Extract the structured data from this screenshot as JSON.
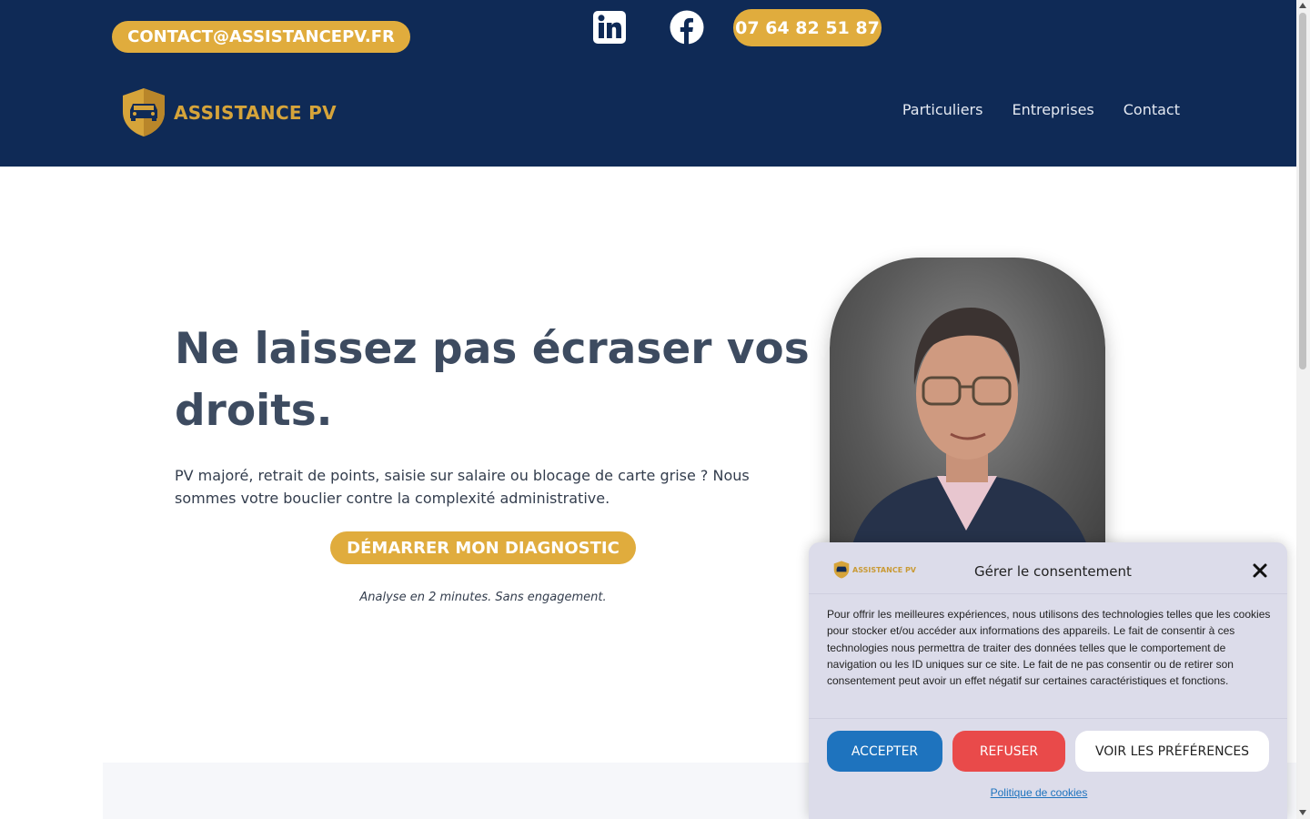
{
  "header": {
    "email_label": "CONTACT@ASSISTANCEPV.FR",
    "phone_label": "07 64 82 51 87",
    "logo_text": "ASSISTANCE PV",
    "social": [
      "linkedin-icon",
      "facebook-icon"
    ],
    "nav": [
      "Particuliers",
      "Entreprises",
      "Contact"
    ]
  },
  "hero": {
    "title": "Ne laissez pas écraser vos droits.",
    "description": "PV majoré, retrait de points, saisie sur salaire ou blocage de carte grise ? Nous sommes votre bouclier contre la complexité administrative.",
    "cta_label": "DÉMARRER MON DIAGNOSTIC",
    "cta_note": "Analyse en 2 minutes. Sans engagement."
  },
  "consent": {
    "logo_text": "ASSISTANCE PV",
    "title": "Gérer le consentement",
    "body": "Pour offrir les meilleures expériences, nous utilisons des technologies telles que les cookies pour stocker et/ou accéder aux informations des appareils. Le fait de consentir à ces technologies nous permettra de traiter des données telles que le comportement de navigation ou les ID uniques sur ce site. Le fait de ne pas consentir ou de retirer son consentement peut avoir un effet négatif sur certaines caractéristiques et fonctions.",
    "accept_label": "ACCEPTER",
    "refuse_label": "REFUSER",
    "prefs_label": "VOIR LES PRÉFÉRENCES",
    "policy_link": "Politique de cookies"
  },
  "colors": {
    "header_bg": "#0f2a56",
    "accent": "#e0ac3d",
    "accept": "#1e73be",
    "refuse": "#e94a4a",
    "consent_bg": "#dcdcea"
  }
}
